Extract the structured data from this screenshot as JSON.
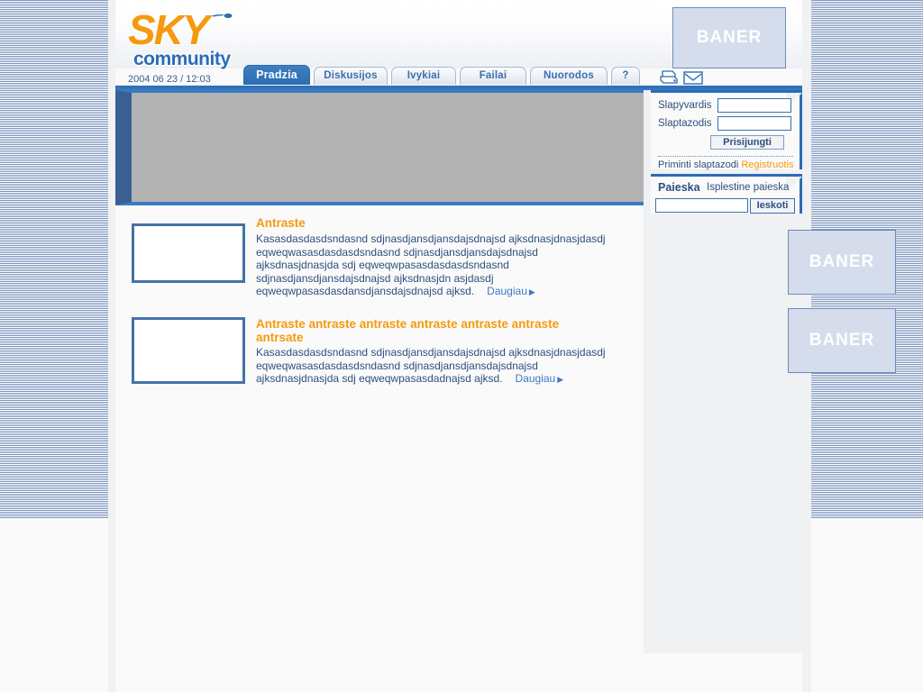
{
  "site": {
    "logo_sky": "SKY",
    "logo_community": "community",
    "datetime": "2004 06 23 / 12:03"
  },
  "banners": {
    "top": "BANER",
    "side_1": "BANER",
    "side_2": "BANER"
  },
  "tabs": [
    {
      "label": "Pradzia",
      "active": true,
      "name": "tab-pradzia"
    },
    {
      "label": "Diskusijos",
      "active": false,
      "name": "tab-diskusijos"
    },
    {
      "label": "Ivykiai",
      "active": false,
      "name": "tab-ivykiai"
    },
    {
      "label": "Failai",
      "active": false,
      "name": "tab-failai"
    },
    {
      "label": "Nuorodos",
      "active": false,
      "name": "tab-nuorodos"
    },
    {
      "label": "?",
      "active": false,
      "name": "tab-help"
    }
  ],
  "toolbar": {
    "print_icon": "printer-icon",
    "mail_icon": "envelope-icon"
  },
  "login": {
    "username_label": "Slapyvardis",
    "username_value": "",
    "username_placeholder": "",
    "password_label": "Slaptazodis",
    "password_value": "",
    "password_placeholder": "",
    "submit_label": "Prisijungti",
    "remind_label": "Priminti slaptazodi",
    "register_label": "Registruotis"
  },
  "search": {
    "title": "Paieska",
    "advanced_label": "Isplestine paieska",
    "input_value": "",
    "input_placeholder": "",
    "button_label": "Ieskoti"
  },
  "articles": [
    {
      "title": "Antraste",
      "body": "Kasasdasdasdsndasnd sdjnasdjansdjansdajsdnajsd ajksdnasjdnasjdasdj eqweqwasasdasdasdsndasnd sdjnasdjansdjansdajsdnajsd ajksdnasjdnasjda sdj eqweqwpasasdasdasdsndasnd sdjnasdjansdjansdajsdnajsd ajksdnasjdn asjdasdj eqweqwpasasdasdansdjansdajsdnajsd ajksd.",
      "more_label": "Daugiau"
    },
    {
      "title": "Antraste antraste antraste antraste antraste antraste antrsate",
      "body": "Kasasdasdasdsndasnd sdjnasdjansdjansdajsdnajsd ajksdnasjdnasjdasdj eqweqwasasdasdasdsndasnd sdjnasdjansdjansdajsdnajsd ajksdnasjdnasjda sdj eqweqwpasasdadnajsd ajksd.",
      "more_label": "Daugiau"
    }
  ],
  "colors": {
    "brand_blue": "#2b6cb5",
    "brand_orange": "#f59a0e",
    "text_blue": "#2f4f7f",
    "panel_bg": "#f0f1f3",
    "hero_placeholder": "#b3b3b3"
  }
}
